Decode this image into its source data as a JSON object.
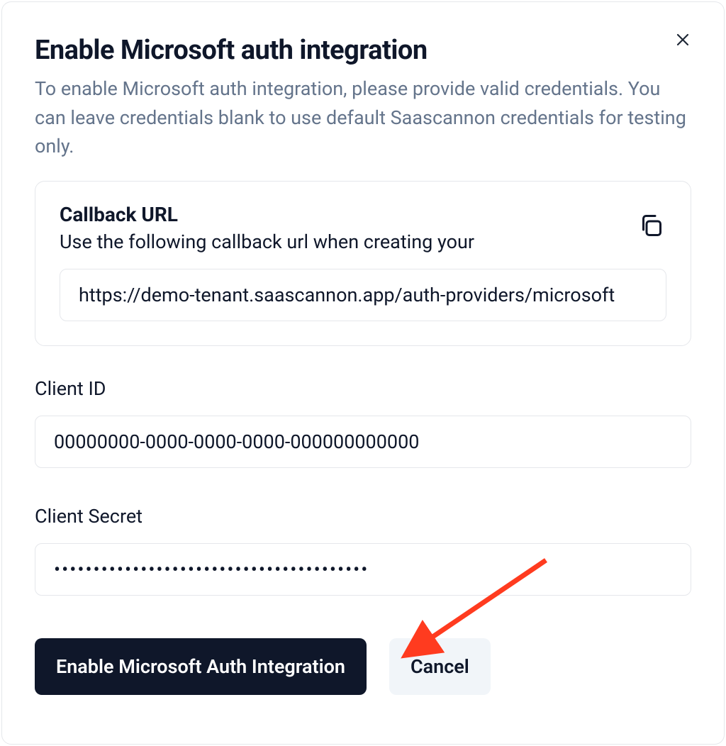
{
  "dialog": {
    "title": "Enable Microsoft auth integration",
    "subtitle": "To enable Microsoft auth integration, please provide valid credentials. You can leave credentials blank to use default Saascannon credentials for testing only.",
    "callback": {
      "title": "Callback URL",
      "description": "Use the following callback url when creating your",
      "url": "https://demo-tenant.saascannon.app/auth-providers/microsoft"
    },
    "client_id": {
      "label": "Client ID",
      "placeholder": "00000000-0000-0000-0000-000000000000",
      "value": ""
    },
    "client_secret": {
      "label": "Client Secret",
      "value": "........................................"
    },
    "buttons": {
      "primary": "Enable Microsoft Auth Integration",
      "cancel": "Cancel"
    }
  }
}
